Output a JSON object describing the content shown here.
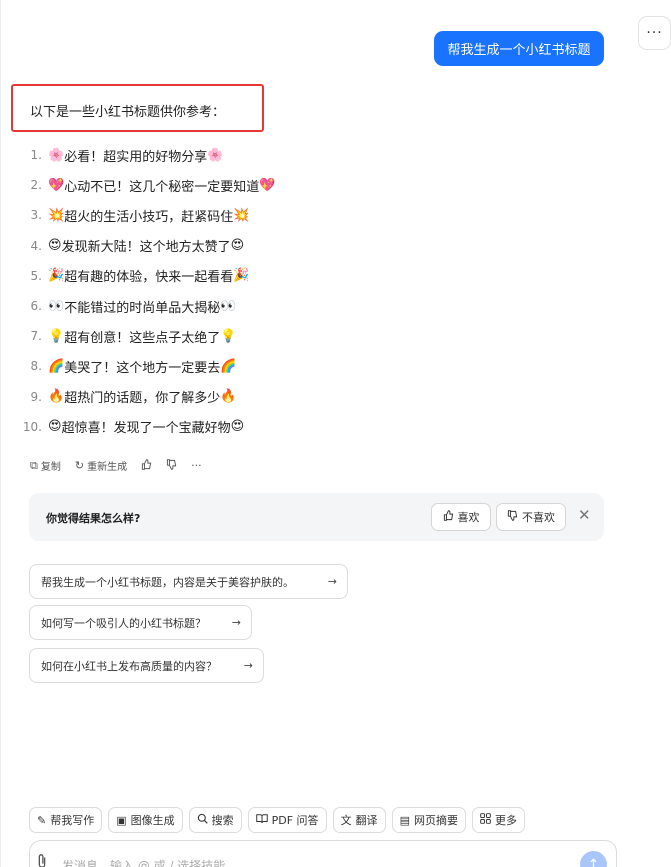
{
  "header": {
    "more_label": "···"
  },
  "user_message": "帮我生成一个小红书标题",
  "reply": {
    "intro": "以下是一些小红书标题供你参考：",
    "items": [
      {
        "num": "1.",
        "emoji": "🌸",
        "text": "必看！超实用的好物分享",
        "emoji_end": "🌸"
      },
      {
        "num": "2.",
        "emoji": "💖",
        "text": "心动不已！这几个秘密一定要知道",
        "emoji_end": "💖"
      },
      {
        "num": "3.",
        "emoji": "💥",
        "text": "超火的生活小技巧，赶紧码住",
        "emoji_end": "💥"
      },
      {
        "num": "4.",
        "emoji": "😍",
        "text": "发现新大陆！这个地方太赞了",
        "emoji_end": "😍"
      },
      {
        "num": "5.",
        "emoji": "🎉",
        "text": "超有趣的体验，快来一起看看",
        "emoji_end": "🎉"
      },
      {
        "num": "6.",
        "emoji": "👀",
        "text": "不能错过的时尚单品大揭秘",
        "emoji_end": "👀"
      },
      {
        "num": "7.",
        "emoji": "💡",
        "text": "超有创意！这些点子太绝了",
        "emoji_end": "💡"
      },
      {
        "num": "8.",
        "emoji": "🌈",
        "text": "美哭了！这个地方一定要去",
        "emoji_end": "🌈"
      },
      {
        "num": "9.",
        "emoji": "🔥",
        "text": "超热门的话题，你了解多少",
        "emoji_end": "🔥"
      },
      {
        "num": "10.",
        "emoji": "😍",
        "text": "超惊喜！发现了一个宝藏好物",
        "emoji_end": "😍"
      }
    ]
  },
  "actions": {
    "copy_label": "复制",
    "regenerate_label": "重新生成",
    "more_label": "···"
  },
  "feedback": {
    "question": "你觉得结果怎么样?",
    "like_label": "喜欢",
    "dislike_label": "不喜欢",
    "close_label": "✕"
  },
  "suggestions": [
    "帮我生成一个小红书标题，内容是关于美容护肤的。",
    "如何写一个吸引人的小红书标题？",
    "如何在小红书上发布高质量的内容？"
  ],
  "toolbar": {
    "items": [
      {
        "label": "帮我写作",
        "icon": "pen-icon"
      },
      {
        "label": "图像生成",
        "icon": "image-icon"
      },
      {
        "label": "搜索",
        "icon": "search-icon"
      },
      {
        "label": "PDF 问答",
        "icon": "book-icon"
      },
      {
        "label": "翻译",
        "icon": "translate-icon"
      },
      {
        "label": "网页摘要",
        "icon": "page-icon"
      },
      {
        "label": "更多",
        "icon": "grid-icon"
      }
    ]
  },
  "composer": {
    "placeholder": "发消息、输入 @ 或 / 选择技能"
  },
  "colors": {
    "accent": "#1a73ff",
    "highlight_border": "#e53935",
    "send_button": "#a9c6fb"
  }
}
